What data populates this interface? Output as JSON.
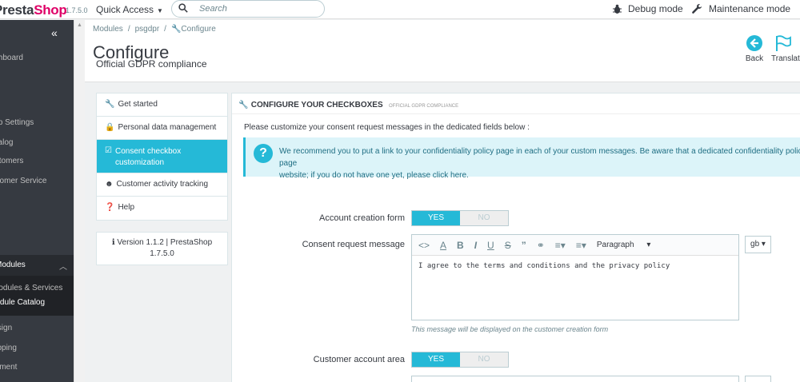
{
  "header": {
    "logo_main": "Presta",
    "logo_shop": "Shop",
    "version": "1.7.5.0",
    "quick_access": "Quick Access",
    "search_placeholder": "Search",
    "debug_mode": "Debug mode",
    "maintenance_mode": "Maintenance mode"
  },
  "sidebar": {
    "collapse_glyph": "«",
    "items": {
      "dashboard": "Dashboard",
      "shop_settings": "Shop Settings",
      "catalog": "Catalog",
      "customers": "Customers",
      "customer_service": "Customer Service",
      "modules": "Modules",
      "modules_services": "Modules & Services",
      "module_catalog": "Module Catalog",
      "design": "Design",
      "shipping": "Shipping",
      "payment": "Payment"
    }
  },
  "toolbar": {
    "breadcrumb": [
      "Modules",
      "psgdpr",
      "Configure"
    ],
    "title": "Configure",
    "subtitle": "Official GDPR compliance",
    "back": "Back",
    "translate": "Translate"
  },
  "module_menu": {
    "items": [
      {
        "label": "Get started",
        "icon": "wrench-icon"
      },
      {
        "label": "Personal data management",
        "icon": "lock-icon"
      },
      {
        "label": "Consent checkbox customization",
        "icon": "checkbox-icon"
      },
      {
        "label": "Customer activity tracking",
        "icon": "user-icon"
      },
      {
        "label": "Help",
        "icon": "question-icon"
      }
    ],
    "active_index": 2,
    "version_line1": "Version 1.1.2 | PrestaShop",
    "version_line2": "1.7.5.0"
  },
  "panel": {
    "title": "Configure your checkboxes",
    "title_small": "Official GDPR compliance",
    "intro": "Please customize your consent request messages in the dedicated fields below :",
    "alert_text": "We recommend you to put a link to your confidentiality policy page in each of your custom messages. Be aware that a dedicated confidentiality policy page",
    "alert_text2": "website; if you do not have one yet, please click ",
    "alert_link": "here",
    "alert_end": "."
  },
  "form": {
    "account_creation_label": "Account creation form",
    "consent_label": "Consent request message",
    "customer_account_label": "Customer account area",
    "yes": "YES",
    "no": "NO",
    "editor_paragraph": "Paragraph",
    "editor_content": "I agree to the terms and conditions and the privacy policy",
    "help_text": "This message will be displayed on the customer creation form",
    "lang": "gb"
  },
  "colors": {
    "accent": "#25b9d7",
    "logo_pink": "#df0067",
    "sidebar_bg": "#363a41"
  }
}
